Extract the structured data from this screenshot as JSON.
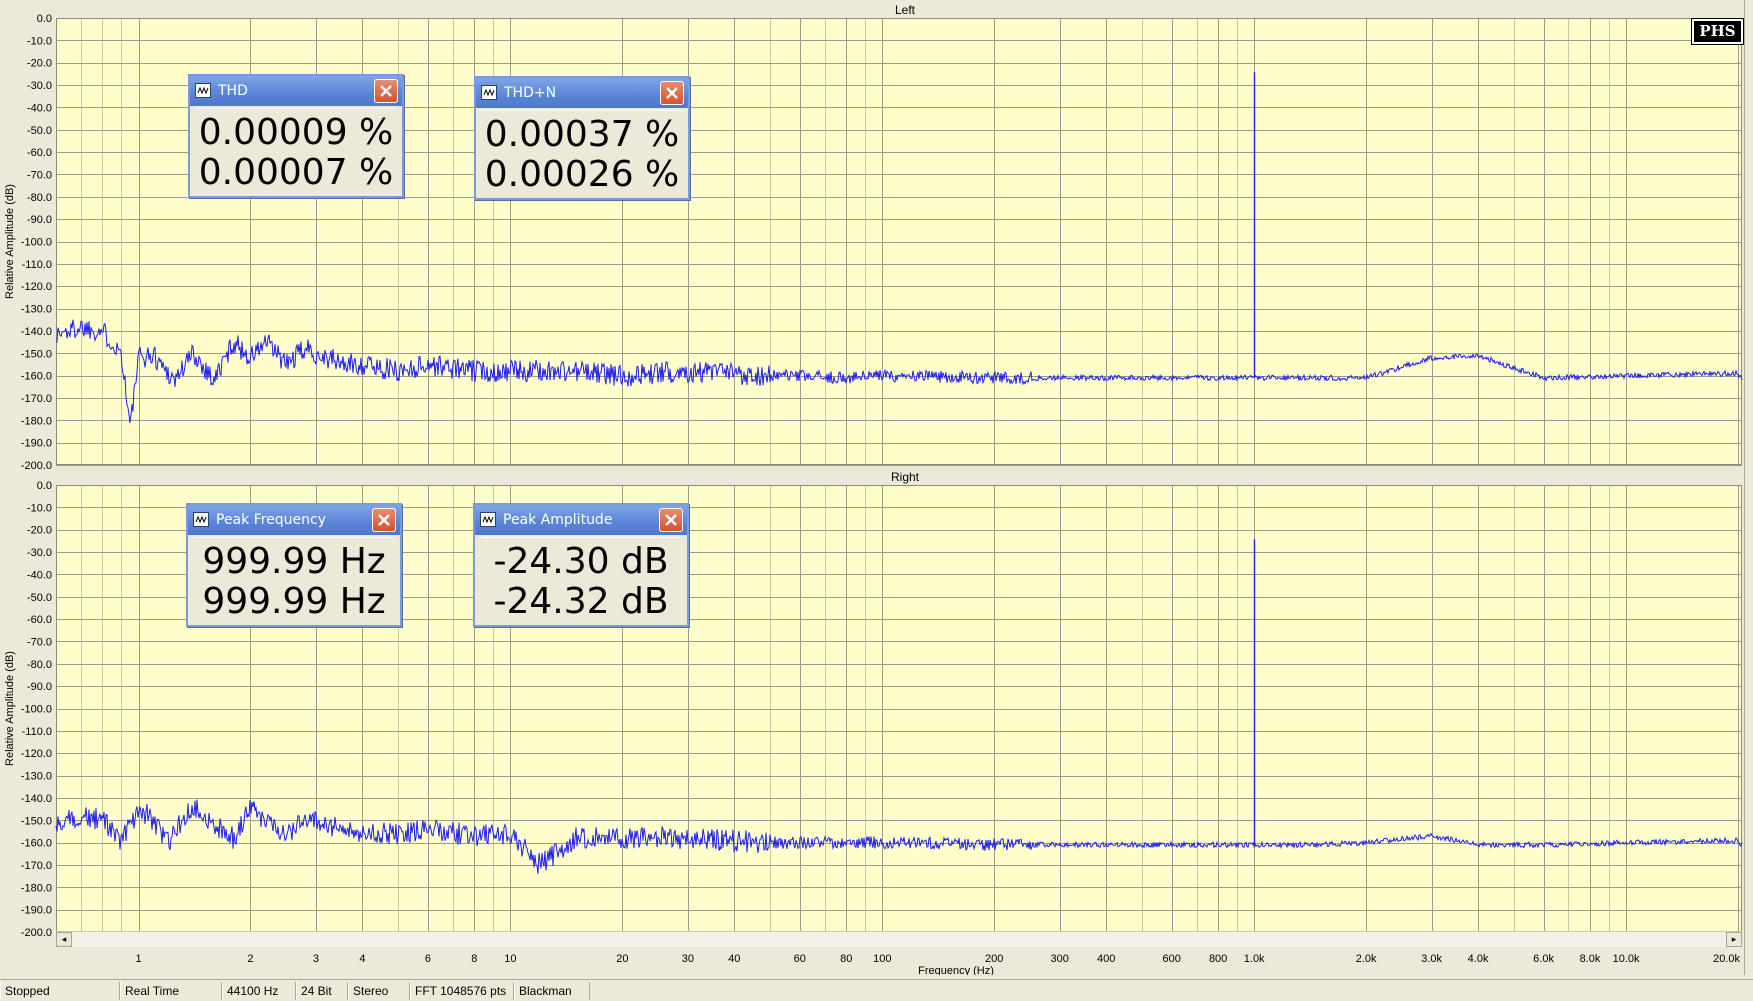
{
  "logo": "PHS",
  "chart_data": [
    {
      "type": "line",
      "title": "Left",
      "xlabel": "Frequency (Hz)",
      "ylabel": "Relative Amplitude (dB)",
      "xscale": "log",
      "xlim": [
        0.6,
        20500
      ],
      "ylim": [
        -200,
        0
      ],
      "grid": true,
      "y_ticks": [
        "0.0",
        "-10.0",
        "-20.0",
        "-30.0",
        "-40.0",
        "-50.0",
        "-60.0",
        "-70.0",
        "-80.0",
        "-90.0",
        "-100.0",
        "-110.0",
        "-120.0",
        "-130.0",
        "-140.0",
        "-150.0",
        "-160.0",
        "-170.0",
        "-180.0",
        "-190.0",
        "-200.0"
      ],
      "x_ticks": [
        "1",
        "2",
        "3",
        "4",
        "6",
        "8",
        "10",
        "20",
        "30",
        "40",
        "60",
        "80",
        "100",
        "200",
        "300",
        "400",
        "600",
        "800",
        "1.0k",
        "2.0k",
        "3.0k",
        "4.0k",
        "6.0k",
        "8.0k",
        "10.0k",
        "20.0k"
      ],
      "series": [
        {
          "color": "#1d1df0",
          "x": [
            0.6,
            0.7,
            0.8,
            0.9,
            0.95,
            1.0,
            1.1,
            1.25,
            1.4,
            1.6,
            1.8,
            2.0,
            2.2,
            2.5,
            2.8,
            3.2,
            3.6,
            4,
            5,
            6,
            8,
            10,
            15,
            20,
            30,
            50,
            80,
            100,
            200,
            400,
            700,
            999.99,
            1500,
            2000,
            3000,
            4000,
            6000,
            10000,
            20000
          ],
          "y": [
            -142,
            -138,
            -140,
            -150,
            -183,
            -152,
            -151,
            -162,
            -150,
            -162,
            -145,
            -152,
            -145,
            -155,
            -148,
            -152,
            -155,
            -155,
            -158,
            -155,
            -158,
            -158,
            -158,
            -160,
            -158,
            -160,
            -161,
            -160,
            -161,
            -161,
            -161,
            -24.3,
            -161,
            -161,
            -152,
            -151,
            -161,
            -160,
            -159
          ]
        }
      ]
    },
    {
      "type": "line",
      "title": "Right",
      "xlabel": "Frequency (Hz)",
      "ylabel": "Relative Amplitude (dB)",
      "xscale": "log",
      "xlim": [
        0.6,
        20500
      ],
      "ylim": [
        -200,
        0
      ],
      "grid": true,
      "y_ticks": [
        "0.0",
        "-10.0",
        "-20.0",
        "-30.0",
        "-40.0",
        "-50.0",
        "-60.0",
        "-70.0",
        "-80.0",
        "-90.0",
        "-100.0",
        "-110.0",
        "-120.0",
        "-130.0",
        "-140.0",
        "-150.0",
        "-160.0",
        "-170.0",
        "-180.0",
        "-190.0",
        "-200.0"
      ],
      "x_ticks": [
        "1",
        "2",
        "3",
        "4",
        "6",
        "8",
        "10",
        "20",
        "30",
        "40",
        "60",
        "80",
        "100",
        "200",
        "300",
        "400",
        "600",
        "800",
        "1.0k",
        "2.0k",
        "3.0k",
        "4.0k",
        "6.0k",
        "8.0k",
        "10.0k",
        "20.0k"
      ],
      "series": [
        {
          "color": "#1d1df0",
          "x": [
            0.6,
            0.7,
            0.8,
            0.9,
            1.0,
            1.1,
            1.2,
            1.4,
            1.6,
            1.8,
            2.0,
            2.2,
            2.5,
            2.8,
            3.2,
            3.6,
            4,
            5,
            6,
            8,
            10,
            12,
            15,
            20,
            30,
            50,
            80,
            100,
            200,
            400,
            700,
            999.99,
            1500,
            2000,
            3000,
            4000,
            6000,
            10000,
            20000
          ],
          "y": [
            -153,
            -148,
            -150,
            -160,
            -145,
            -150,
            -160,
            -143,
            -152,
            -158,
            -145,
            -150,
            -156,
            -150,
            -152,
            -154,
            -155,
            -156,
            -154,
            -157,
            -156,
            -170,
            -158,
            -158,
            -158,
            -160,
            -160,
            -160,
            -161,
            -161,
            -161,
            -24.32,
            -161,
            -160,
            -157,
            -161,
            -161,
            -160,
            -159
          ]
        }
      ]
    }
  ],
  "meters": {
    "thd": {
      "title": "THD",
      "values": [
        "0.00009 %",
        "0.00007 %"
      ]
    },
    "thdn": {
      "title": "THD+N",
      "values": [
        "0.00037 %",
        "0.00026 %"
      ]
    },
    "peak_freq": {
      "title": "Peak Frequency",
      "values": [
        "999.99 Hz",
        "999.99 Hz"
      ]
    },
    "peak_amp": {
      "title": "Peak Amplitude",
      "values": [
        "-24.30 dB",
        "-24.32 dB"
      ]
    }
  },
  "status": {
    "state": "Stopped",
    "mode": "Real Time",
    "rate": "44100 Hz",
    "bits": "24 Bit",
    "channels": "Stereo",
    "fft": "FFT 1048576 pts",
    "window": "Blackman"
  },
  "scrollbar": {
    "left_arrow": "◂",
    "right_arrow": "▸"
  }
}
